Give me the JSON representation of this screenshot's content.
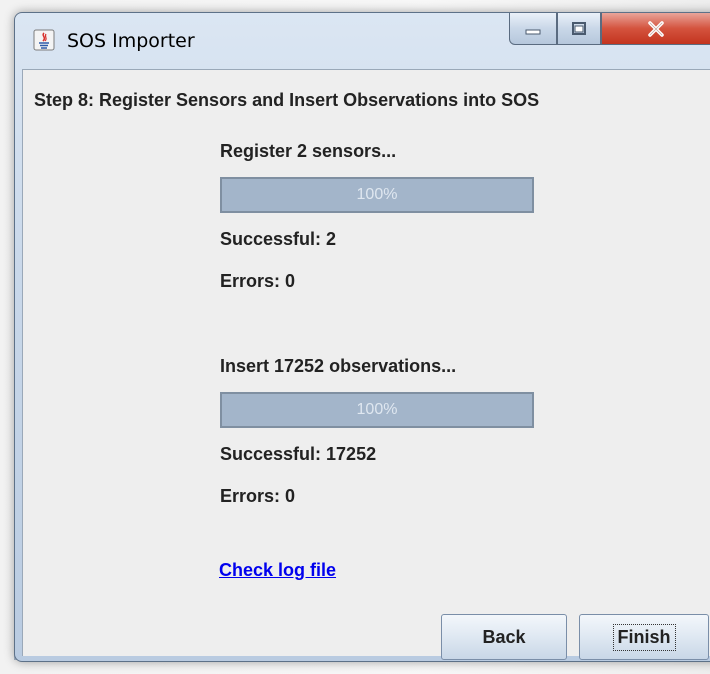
{
  "window": {
    "title": "SOS Importer",
    "controls": {
      "minimize_icon": "minimize-icon",
      "maximize_icon": "maximize-icon",
      "close_icon": "close-icon"
    }
  },
  "step": {
    "title": "Step 8: Register Sensors and Insert Observations into SOS"
  },
  "sensors": {
    "label": "Register 2 sensors...",
    "progress_percent": 100,
    "progress_text": "100%",
    "successful": "Successful: 2",
    "errors": "Errors: 0"
  },
  "observations": {
    "label": "Insert 17252 observations...",
    "progress_percent": 100,
    "progress_text": "100%",
    "successful": "Successful: 17252",
    "errors": "Errors: 0"
  },
  "log_link": "Check log file",
  "buttons": {
    "back": "Back",
    "finish": "Finish"
  },
  "colors": {
    "progress_fill": "#a3b5ca",
    "link": "#0000ee",
    "close_button": "#c3341f"
  }
}
